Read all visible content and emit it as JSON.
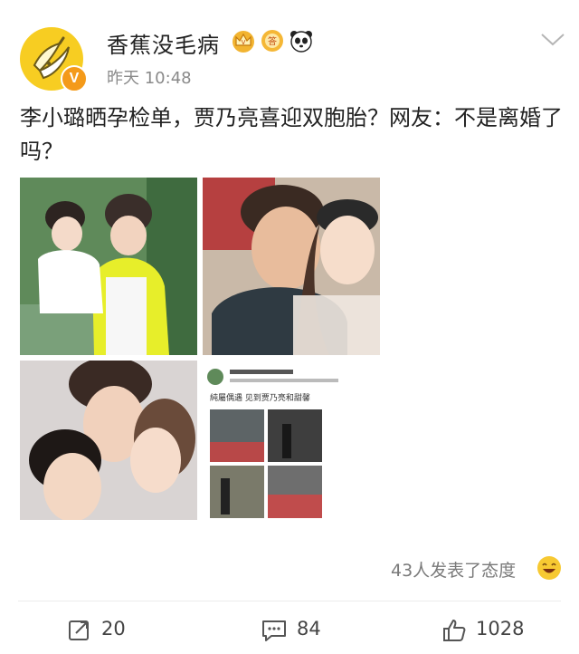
{
  "post": {
    "username": "香蕉没毛病",
    "timestamp": "昨天 10:48",
    "verified_badge": "V",
    "text": "李小璐晒孕检单，贾乃亮喜迎双胞胎？网友：不是离婚了吗？",
    "badges": [
      "crown-icon",
      "medal-icon",
      "panda-icon"
    ]
  },
  "embedded_screenshot": {
    "caption": "純屬偶遇 见到贾乃亮和甜馨"
  },
  "reactions": {
    "summary": "43人发表了态度"
  },
  "actions": {
    "repost_count": "20",
    "comment_count": "84",
    "like_count": "1028"
  },
  "colors": {
    "accent_yellow": "#f7cd22",
    "verified_orange": "#f49a1a",
    "muted_text": "#8a8a8a"
  }
}
